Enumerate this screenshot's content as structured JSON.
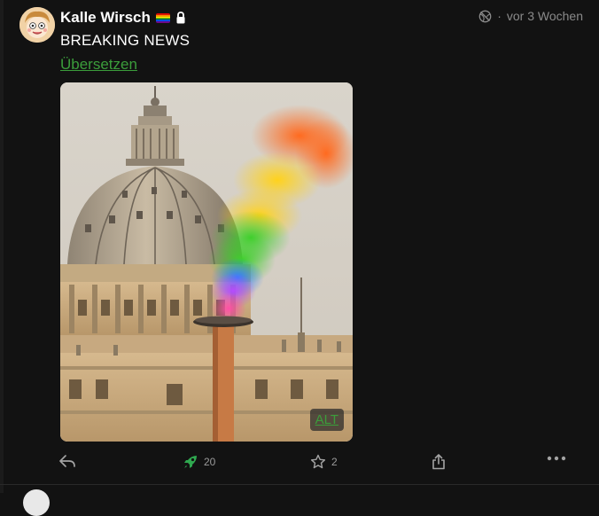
{
  "post": {
    "author": {
      "display_name": "Kalle Wirsch",
      "avatar_icon": "cartoon-face-avatar",
      "badges": [
        "rainbow-flag-icon",
        "lock-icon"
      ]
    },
    "visibility_icon": "globe-off-icon",
    "timestamp": "vor 3 Wochen",
    "content": "BREAKING NEWS",
    "translate_label": "Übersetzen",
    "media": {
      "alt_label": "ALT"
    },
    "actions": {
      "reply_icon": "reply-icon",
      "boost_icon": "rocket-icon",
      "boost_count": "20",
      "favourite_icon": "star-icon",
      "favourite_count": "2",
      "share_icon": "share-icon",
      "more_icon": "more-icon"
    }
  },
  "colors": {
    "background": "#121212",
    "link": "#3b9d3b",
    "boost_active": "#2fa84f",
    "muted": "#8a8a8a"
  }
}
